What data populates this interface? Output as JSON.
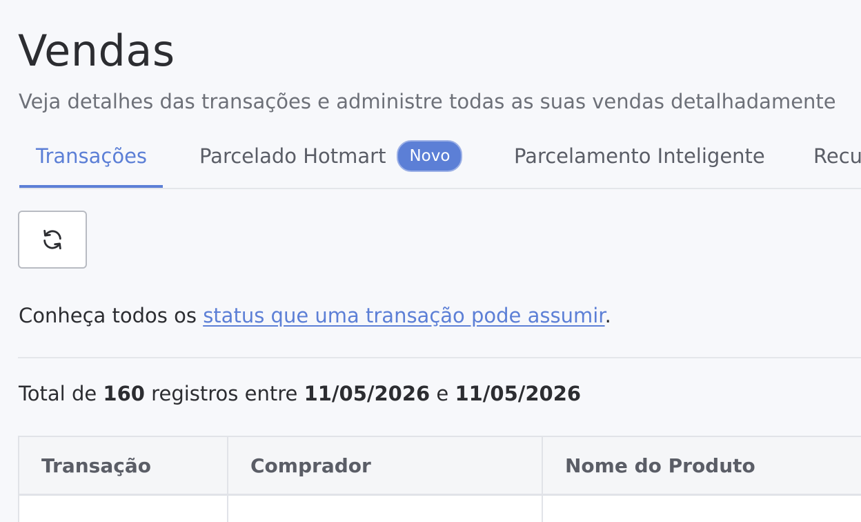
{
  "page": {
    "title": "Vendas",
    "subtitle": "Veja detalhes das transações e administre todas as suas vendas detalhadamente"
  },
  "tabs": [
    {
      "label": "Transações",
      "active": true
    },
    {
      "label": "Parcelado Hotmart",
      "badge": "Novo"
    },
    {
      "label": "Parcelamento Inteligente"
    },
    {
      "label": "Recu"
    }
  ],
  "toolbar": {
    "refresh_icon": "refresh-icon"
  },
  "info": {
    "prefix": "Conheça todos os ",
    "link_text": "status que uma transação pode assumir",
    "suffix": "."
  },
  "summary": {
    "prefix": "Total de ",
    "count": "160",
    "middle": " registros entre ",
    "start_date": "11/05/2026",
    "connector": " e ",
    "end_date": "11/05/2026"
  },
  "table": {
    "columns": [
      "Transação",
      "Comprador",
      "Nome do Produto"
    ]
  },
  "colors": {
    "accent": "#5c7fd6",
    "background": "#f7f8fb"
  }
}
